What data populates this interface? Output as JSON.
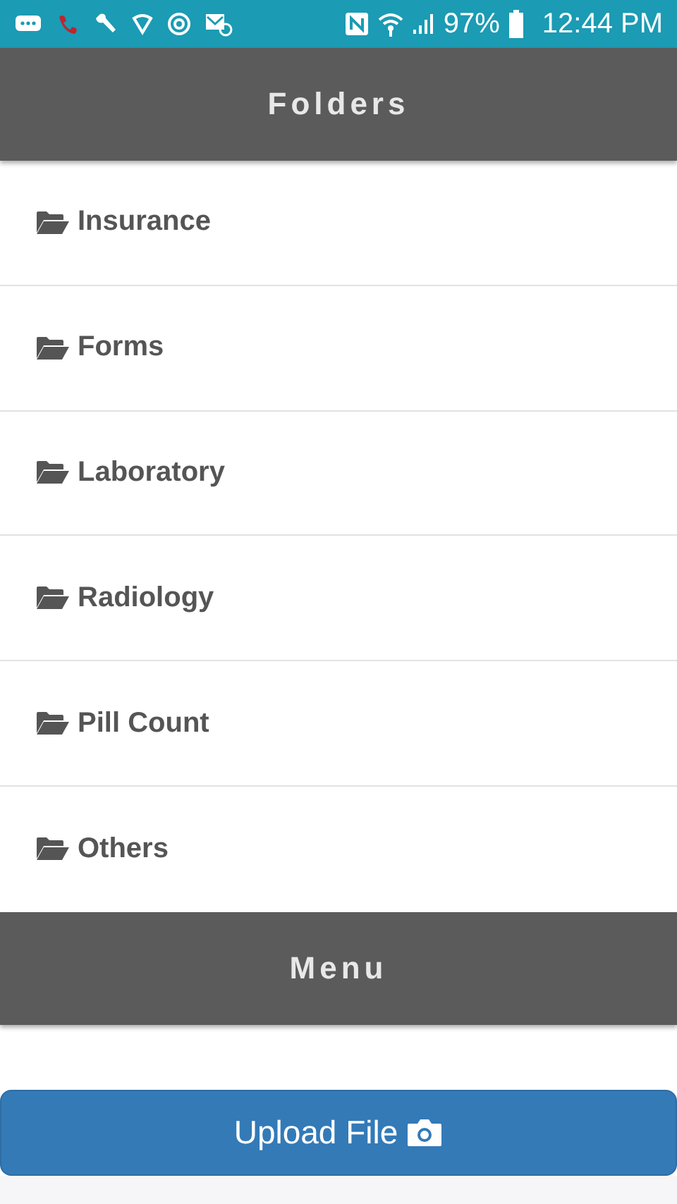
{
  "status_bar": {
    "battery": "97%",
    "time": "12:44 PM"
  },
  "header": {
    "title": "Folders"
  },
  "folders": [
    {
      "label": "Insurance"
    },
    {
      "label": "Forms"
    },
    {
      "label": "Laboratory"
    },
    {
      "label": "Radiology"
    },
    {
      "label": "Pill Count"
    },
    {
      "label": "Others"
    }
  ],
  "menu_header": {
    "title": "Menu"
  },
  "upload_button": {
    "label": "Upload File"
  }
}
